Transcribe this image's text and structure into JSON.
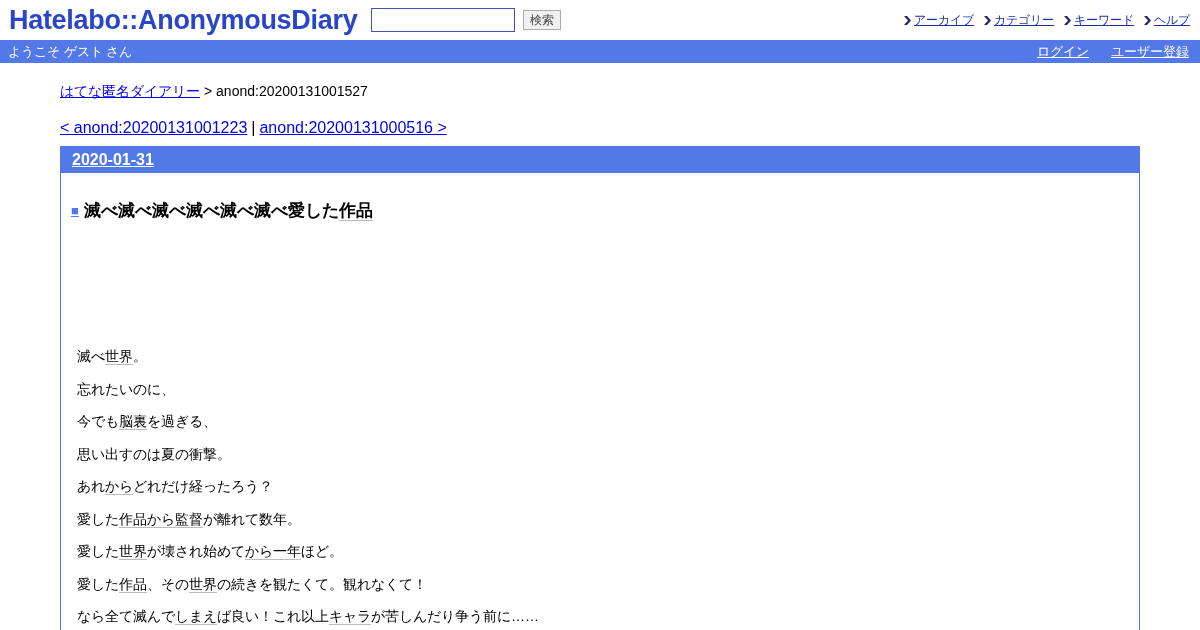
{
  "header": {
    "logo": "Hatelabo::AnonymousDiary",
    "search": {
      "button": "検索"
    },
    "links": [
      "アーカイブ",
      "カテゴリー",
      "キーワード",
      "ヘルプ"
    ]
  },
  "welcome_bar": {
    "greeting": "ようこそ ゲスト さん",
    "links": [
      "ログイン",
      "ユーザー登録"
    ]
  },
  "breadcrumb": {
    "link": "はてな匿名ダイアリー",
    "current": "> anond:20200131001527"
  },
  "pager": {
    "prev": "< anond:20200131001223",
    "separator": "|",
    "next": "anond:20200131000516 >"
  },
  "day": {
    "date": "2020-01-31",
    "marker": "■",
    "title": [
      {
        "text": "滅べ滅べ滅べ滅べ滅べ滅べ愛した",
        "keyword": false
      },
      {
        "text": "作品",
        "keyword": true
      }
    ],
    "paragraphs": [
      [
        {
          "text": "滅べ",
          "keyword": false
        },
        {
          "text": "世界",
          "keyword": true
        },
        {
          "text": "。",
          "keyword": false
        }
      ],
      [
        {
          "text": "忘れたいのに、",
          "keyword": false
        }
      ],
      [
        {
          "text": "今でも",
          "keyword": false
        },
        {
          "text": "脳裏",
          "keyword": true
        },
        {
          "text": "を過ぎる、",
          "keyword": false
        }
      ],
      [
        {
          "text": "思い出すのは夏の衝撃。",
          "keyword": false
        }
      ],
      [
        {
          "text": "あれ",
          "keyword": false
        },
        {
          "text": "から",
          "keyword": true
        },
        {
          "text": "どれだけ経ったろう？",
          "keyword": false
        }
      ],
      [
        {
          "text": "愛した",
          "keyword": false
        },
        {
          "text": "作品",
          "keyword": true
        },
        {
          "text": "から",
          "keyword": true
        },
        {
          "text": "監督",
          "keyword": true
        },
        {
          "text": "が離れて数年。",
          "keyword": false
        }
      ],
      [
        {
          "text": "愛した",
          "keyword": false
        },
        {
          "text": "世界",
          "keyword": true
        },
        {
          "text": "が壊され始めて",
          "keyword": false
        },
        {
          "text": "から",
          "keyword": true
        },
        {
          "text": "一年",
          "keyword": true
        },
        {
          "text": "ほど。",
          "keyword": false
        }
      ],
      [
        {
          "text": "愛した",
          "keyword": false
        },
        {
          "text": "作品",
          "keyword": true
        },
        {
          "text": "、その",
          "keyword": false
        },
        {
          "text": "世界",
          "keyword": true
        },
        {
          "text": "の続きを観たくて。観れなくて！",
          "keyword": false
        }
      ],
      [
        {
          "text": "なら全て滅んで",
          "keyword": false
        },
        {
          "text": "しまえ",
          "keyword": true
        },
        {
          "text": "ば良い！これ以上",
          "keyword": false
        },
        {
          "text": "キャラ",
          "keyword": true
        },
        {
          "text": "が苦しんだり争う前に……",
          "keyword": false
        }
      ]
    ]
  }
}
